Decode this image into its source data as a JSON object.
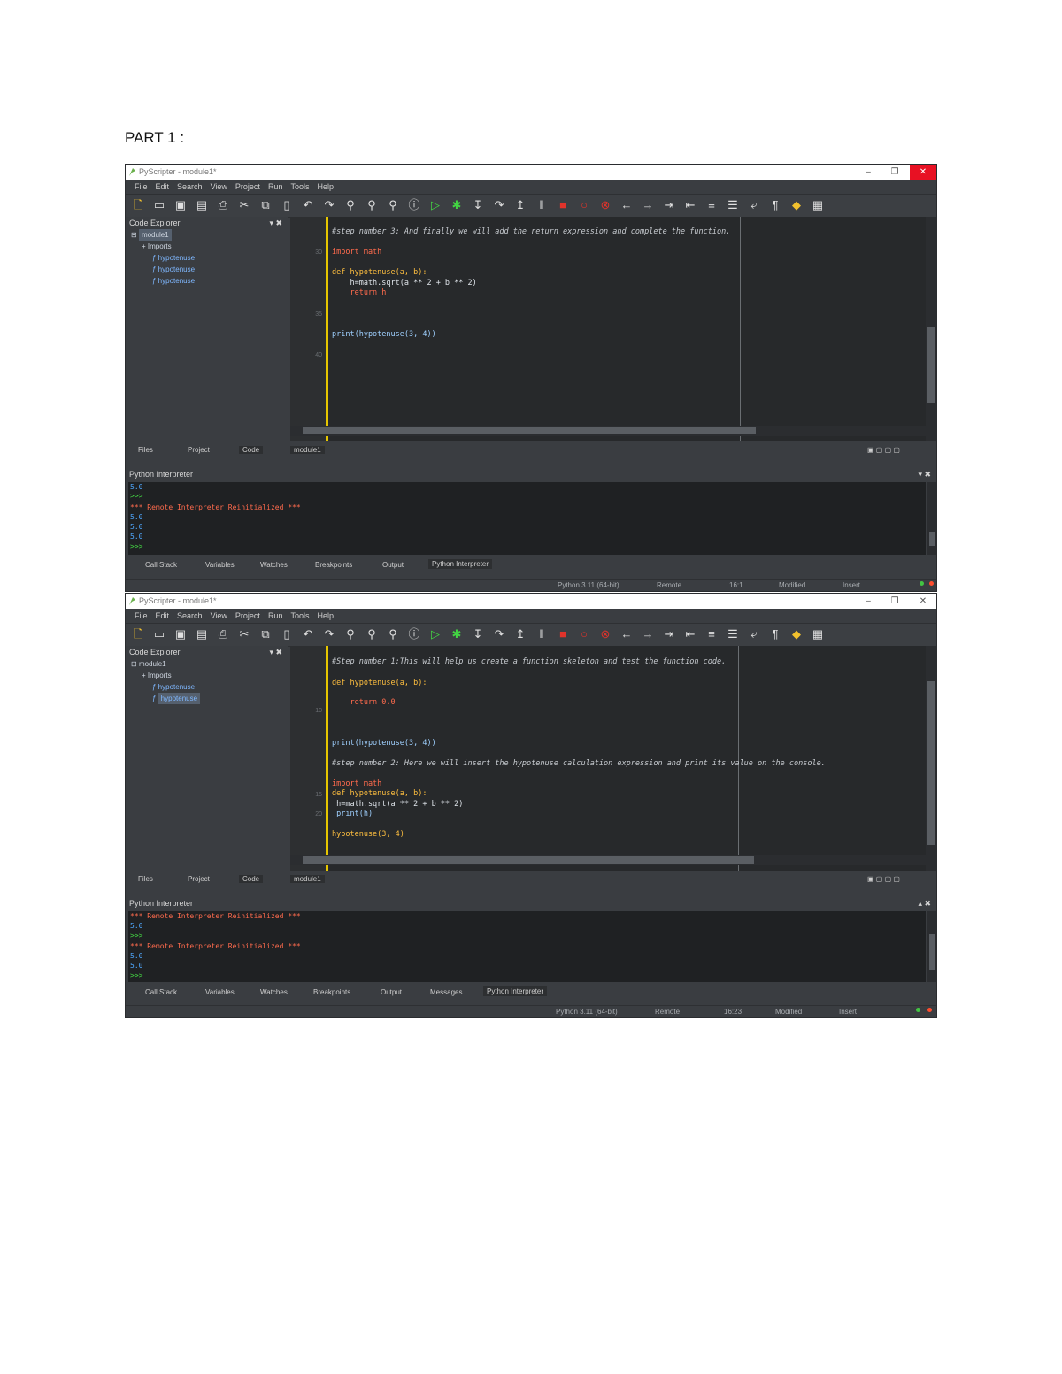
{
  "page_title": "PART 1 :",
  "screens": [
    {
      "window_title": "PyScripter - module1*",
      "menu": [
        "File",
        "Edit",
        "Search",
        "View",
        "Project",
        "Run",
        "Tools",
        "Help"
      ],
      "explorer": {
        "title": "Code Explorer",
        "controls": "▾ ✖",
        "tree": [
          "module1",
          "Imports",
          "hypotenuse",
          "hypotenuse",
          "hypotenuse"
        ]
      },
      "gutter_numbers": [
        "30",
        "35",
        "40"
      ],
      "code_lines": [
        {
          "text": "#step number 3: And finally we will add the return expression and complete the function.",
          "cls": "c-com"
        },
        {
          "text": "import math",
          "cls": "c-kw"
        },
        {
          "text": "def hypotenuse(a, b):",
          "cls": "c-fn"
        },
        {
          "text": "    h=math.sqrt(a ** 2 + b ** 2)",
          "cls": "c-tx"
        },
        {
          "text": "    return h",
          "cls": "c-kw"
        },
        {
          "text": "print(hypotenuse(3, 4))",
          "cls": "c-pr"
        }
      ],
      "left_tabs": [
        "Files",
        "Project",
        "Code"
      ],
      "editor_tab": "module1",
      "interpreter_title": "Python Interpreter",
      "interpreter_controls": "▾ ✖",
      "console_lines": [
        {
          "text": "5.0",
          "cls": "con-n"
        },
        {
          "text": ">>>",
          "cls": "con-p"
        },
        {
          "text": "*** Remote Interpreter Reinitialized ***",
          "cls": "con-r"
        },
        {
          "text": "5.0",
          "cls": "con-n"
        },
        {
          "text": "5.0",
          "cls": "con-n"
        },
        {
          "text": "5.0",
          "cls": "con-n"
        },
        {
          "text": ">>>",
          "cls": "con-p"
        }
      ],
      "bottom_tabs": [
        "Call Stack",
        "Variables",
        "Watches",
        "Breakpoints",
        "Output",
        "Python Interpreter"
      ],
      "status": {
        "python": "Python 3.11 (64-bit)",
        "engine": "Remote",
        "pos": "16:1",
        "state": "Modified",
        "mode": "Insert"
      }
    },
    {
      "window_title": "PyScripter - module1*",
      "menu": [
        "File",
        "Edit",
        "Search",
        "View",
        "Project",
        "Run",
        "Tools",
        "Help"
      ],
      "explorer": {
        "title": "Code Explorer",
        "controls": "▾ ✖",
        "tree": [
          "module1",
          "Imports",
          "hypotenuse",
          "hypotenuse"
        ]
      },
      "gutter_numbers": [
        "10",
        "15",
        "20"
      ],
      "code_lines": [
        {
          "text": "#Step number 1:This will help us create a function skeleton and test the function code.",
          "cls": "c-com"
        },
        {
          "text": "def hypotenuse(a, b):",
          "cls": "c-fn"
        },
        {
          "text": "    return 0.0",
          "cls": "c-kw"
        },
        {
          "text": "print(hypotenuse(3, 4))",
          "cls": "c-pr"
        },
        {
          "text": "#step number 2: Here we will insert the hypotenuse calculation expression and print its value on the console.",
          "cls": "c-com"
        },
        {
          "text": "import math",
          "cls": "c-kw"
        },
        {
          "text": "def hypotenuse(a, b):",
          "cls": "c-fn"
        },
        {
          "text": " h=math.sqrt(a ** 2 + b ** 2)",
          "cls": "c-tx"
        },
        {
          "text": " print(h)",
          "cls": "c-pr"
        },
        {
          "text": "hypotenuse(3, 4)",
          "cls": "c-fn"
        }
      ],
      "left_tabs": [
        "Files",
        "Project",
        "Code"
      ],
      "editor_tab": "module1",
      "interpreter_title": "Python Interpreter",
      "interpreter_controls": "▴ ✖",
      "console_lines": [
        {
          "text": "*** Remote Interpreter Reinitialized ***",
          "cls": "con-r"
        },
        {
          "text": "5.0",
          "cls": "con-n"
        },
        {
          "text": ">>>",
          "cls": "con-p"
        },
        {
          "text": "*** Remote Interpreter Reinitialized ***",
          "cls": "con-r"
        },
        {
          "text": "5.0",
          "cls": "con-n"
        },
        {
          "text": "5.0",
          "cls": "con-n"
        },
        {
          "text": ">>>",
          "cls": "con-p"
        }
      ],
      "bottom_tabs": [
        "Call Stack",
        "Variables",
        "Watches",
        "Breakpoints",
        "Output",
        "Messages",
        "Python Interpreter"
      ],
      "status": {
        "python": "Python 3.11 (64-bit)",
        "engine": "Remote",
        "pos": "16:23",
        "state": "Modified",
        "mode": "Insert"
      }
    }
  ],
  "colors": {
    "dark_bg": "#3a3d41",
    "editor_bg": "#27292b",
    "highlight_bar": "#e6c600",
    "close_red": "#e81123"
  },
  "toolbar_icons": [
    "new-file-icon",
    "open-folder-icon",
    "save-icon",
    "save-all-icon",
    "print-icon",
    "cut-icon",
    "copy-icon",
    "paste-icon",
    "undo-icon",
    "redo-icon",
    "find-icon",
    "find-next-icon",
    "replace-icon",
    "syntax-check-icon",
    "run-icon",
    "debug-icon",
    "step-into-icon",
    "step-over-icon",
    "step-out-icon",
    "pause-icon",
    "stop-icon",
    "breakpoint-icon",
    "clear-breakpoints-icon",
    "back-icon",
    "forward-icon",
    "indent-icon",
    "dedent-icon",
    "comment-icon",
    "list-icon",
    "wrap-icon",
    "pilcrow-icon",
    "python-icon",
    "layout-icon"
  ]
}
